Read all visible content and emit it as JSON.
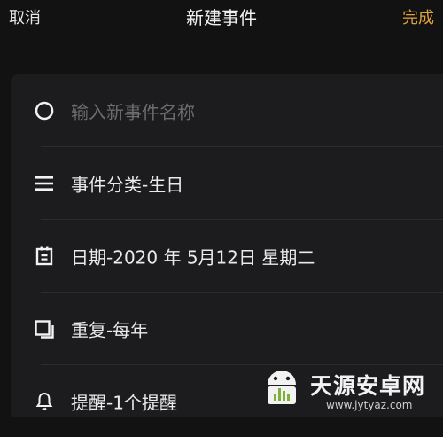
{
  "nav": {
    "cancel_label": "取消",
    "title": "新建事件",
    "done_label": "完成"
  },
  "form": {
    "name_input": {
      "value": "",
      "placeholder": "输入新事件名称"
    },
    "category": {
      "label": "事件分类-生日",
      "icon": "list-icon"
    },
    "date": {
      "label": "日期-2020 年 5月12日 星期二",
      "icon": "calendar-icon"
    },
    "repeat": {
      "label": "重复-每年",
      "icon": "repeat-icon"
    },
    "reminder": {
      "label": "提醒-1个提醒",
      "icon": "bell-icon"
    }
  },
  "watermark": {
    "text": "天源安卓网",
    "url": "www.jytyaz.com"
  },
  "colors": {
    "accent": "#e0a33a",
    "background": "#121212",
    "card": "#1c1c1e"
  }
}
